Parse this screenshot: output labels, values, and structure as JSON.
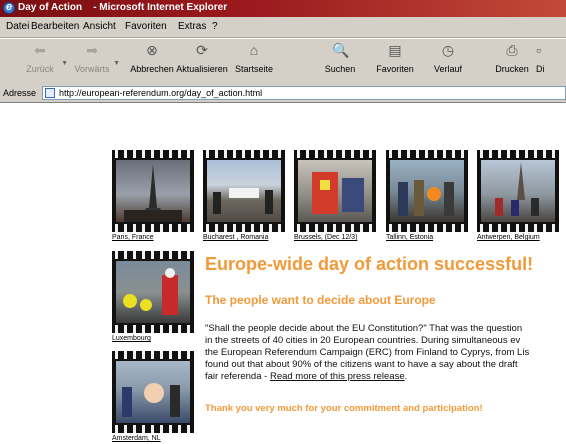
{
  "window": {
    "title": "Day of Action    - Microsoft Internet Explorer"
  },
  "menu": [
    "Datei",
    "Bearbeiten",
    "Ansicht",
    "Favoriten",
    "Extras",
    "?"
  ],
  "toolbar": {
    "back": "Zurück",
    "forward": "Vorwärts",
    "stop": "Abbrechen",
    "refresh": "Aktualisieren",
    "home": "Startseite",
    "search": "Suchen",
    "favorites": "Favoriten",
    "history": "Verlauf",
    "print": "Drucken",
    "more": "Di"
  },
  "address": {
    "label": "Adresse",
    "url": "http://european-referendum.org/day_of_action.html"
  },
  "photos": [
    {
      "caption": "Paris, France"
    },
    {
      "caption": "Bucharest , Romania"
    },
    {
      "caption": "Brussels, (Dec 12/3)"
    },
    {
      "caption": "Tallinn, Estonia"
    },
    {
      "caption": "Antwerpen, Belgium"
    },
    {
      "caption": "Luxembourg"
    },
    {
      "caption": "Amsterdam, NL"
    }
  ],
  "article": {
    "headline": "Europe-wide day of action successful!",
    "subheadline": "The people want to decide about Europe",
    "lines": [
      "\"Shall the people decide about the EU Constitution?\" That was the question",
      "in the streets of 40 cities in 20 European countries. During simultaneous ev",
      "the European Referendum Campaign (ERC) from Finland to Cyprys, from Lis",
      "found out that about 90% of the citizens want to have a say about the draft",
      "fair referenda - "
    ],
    "link": "Read more of this press release",
    "thanks": "Thank you very much for your commitment and participation!"
  }
}
